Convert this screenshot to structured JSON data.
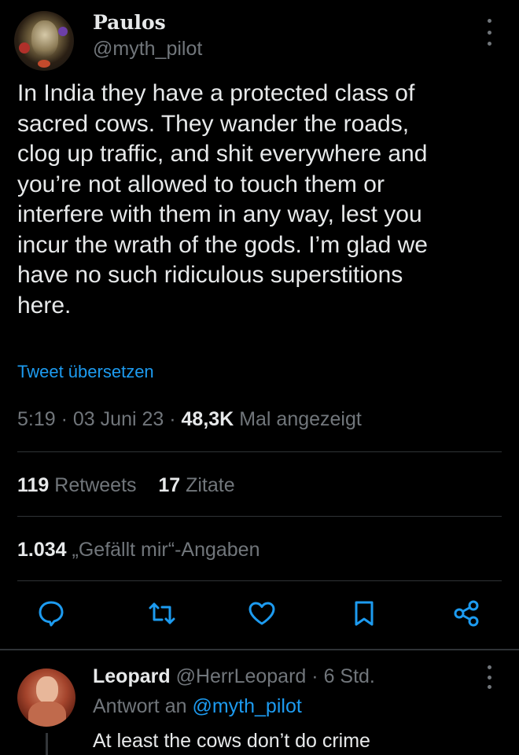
{
  "tweet": {
    "author_name": "Paulos",
    "author_handle": "@myth_pilot",
    "text": "In India they have a protected class of\nsacred cows. They wander the roads,\nclog up traffic, and shit everywhere and\nyou’re not allowed to touch them or\ninterfere with them in any way, lest you\nincur the wrath of the gods. I’m glad we\nhave no such ridiculous superstitions\nhere.",
    "translate_label": "Tweet übersetzen",
    "time": "5:19",
    "date": "03 Juni 23",
    "views_count": "48,3K",
    "views_label": "Mal angezeigt",
    "separator": "·"
  },
  "stats": {
    "retweets_count": "119",
    "retweets_label": "Retweets",
    "quotes_count": "17",
    "quotes_label": "Zitate",
    "likes_count": "1.034",
    "likes_label": "„Gefällt mir“-Angaben"
  },
  "actions": {
    "icons": [
      "reply-icon",
      "retweet-icon",
      "like-icon",
      "bookmark-icon",
      "share-icon"
    ]
  },
  "reply": {
    "author_name": "Leopard",
    "author_handle": "@HerrLeopard",
    "time": "6 Std.",
    "reply_to_label": "Antwort an",
    "reply_to_handle": "@myth_pilot",
    "text": "At least the cows don’t do crime"
  },
  "colors": {
    "background": "#000000",
    "text": "#e7e9ea",
    "secondary": "#71767b",
    "accent": "#1d9bf0",
    "divider": "#2f3336"
  }
}
